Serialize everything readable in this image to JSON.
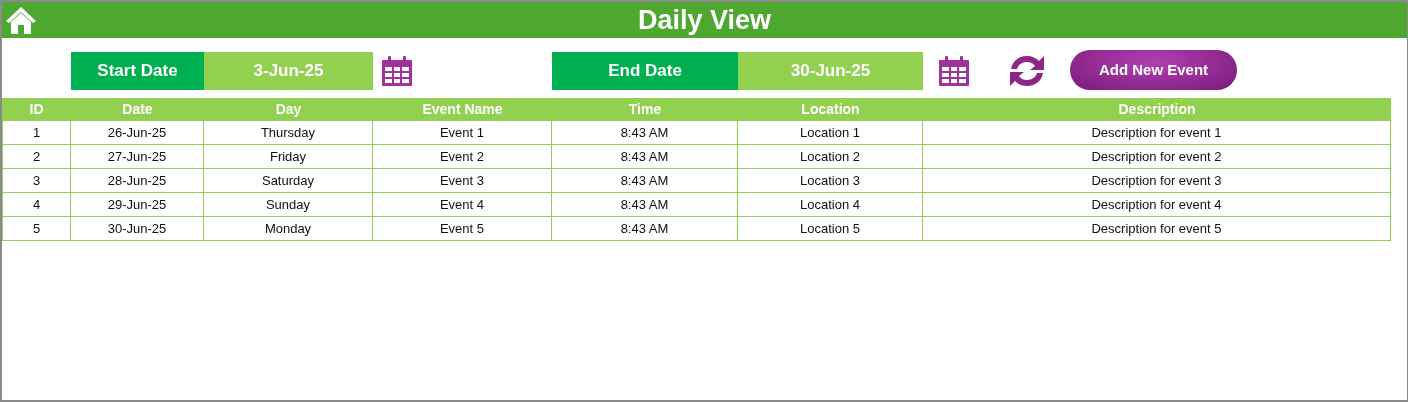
{
  "header": {
    "title": "Daily View"
  },
  "filters": {
    "start_label": "Start Date",
    "start_value": "3-Jun-25",
    "end_label": "End Date",
    "end_value": "30-Jun-25"
  },
  "actions": {
    "add_button": "Add New Event"
  },
  "table": {
    "columns": [
      "ID",
      "Date",
      "Day",
      "Event Name",
      "Time",
      "Location",
      "Description"
    ],
    "rows": [
      [
        "1",
        "26-Jun-25",
        "Thursday",
        "Event 1",
        "8:43 AM",
        "Location 1",
        "Description for event 1"
      ],
      [
        "2",
        "27-Jun-25",
        "Friday",
        "Event 2",
        "8:43 AM",
        "Location 2",
        "Description for event 2"
      ],
      [
        "3",
        "28-Jun-25",
        "Saturday",
        "Event 3",
        "8:43 AM",
        "Location 3",
        "Description for event 3"
      ],
      [
        "4",
        "29-Jun-25",
        "Sunday",
        "Event 4",
        "8:43 AM",
        "Location 4",
        "Description for event 4"
      ],
      [
        "5",
        "30-Jun-25",
        "Monday",
        "Event 5",
        "8:43 AM",
        "Location 5",
        "Description for event 5"
      ]
    ]
  }
}
